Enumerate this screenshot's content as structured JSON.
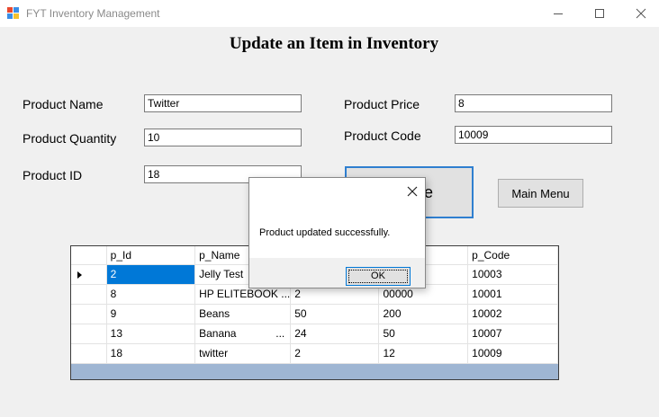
{
  "window": {
    "title": "FYT Inventory Management",
    "icon": "app-icon",
    "controls": [
      "minimize-icon",
      "maximize-icon",
      "close-icon"
    ]
  },
  "form": {
    "heading": "Update an Item in Inventory",
    "product_name": {
      "label": "Product Name",
      "value": "Twitter"
    },
    "product_quantity": {
      "label": "Product Quantity",
      "value": "10"
    },
    "product_id": {
      "label": "Product ID",
      "value": "18"
    },
    "product_price": {
      "label": "Product Price",
      "value": "8"
    },
    "product_code": {
      "label": "Product Code",
      "value": "10009"
    },
    "update_button_visible_text": "e",
    "main_menu_label": "Main Menu"
  },
  "grid": {
    "headers": [
      "p_Id",
      "p_Name",
      "",
      "",
      "p_Code"
    ],
    "rows": [
      {
        "p_Id": "2",
        "p_Name": "Jelly Test",
        "p_Qty": "",
        "p_Price": "",
        "p_Code": "10003",
        "ellipsis": ""
      },
      {
        "p_Id": "8",
        "p_Name": "HP ELITEBOOK ...",
        "p_Qty": "2",
        "p_Price": "00000",
        "p_Code": "10001",
        "ellipsis": ""
      },
      {
        "p_Id": "9",
        "p_Name": "Beans",
        "p_Qty": "50",
        "p_Price": "200",
        "p_Code": "10002",
        "ellipsis": ""
      },
      {
        "p_Id": "13",
        "p_Name": "Banana",
        "p_Qty": "24",
        "p_Price": "50",
        "p_Code": "10007",
        "ellipsis": "..."
      },
      {
        "p_Id": "18",
        "p_Name": "twitter",
        "p_Qty": "2",
        "p_Price": "12",
        "p_Code": "10009",
        "ellipsis": ""
      }
    ],
    "selected_row": 0
  },
  "dialog": {
    "message": "Product updated successfully.",
    "ok_label": "OK"
  },
  "colors": {
    "selection": "#0078d7",
    "grid_background": "#9fb6d3",
    "focus_border": "#2f7fd0"
  }
}
